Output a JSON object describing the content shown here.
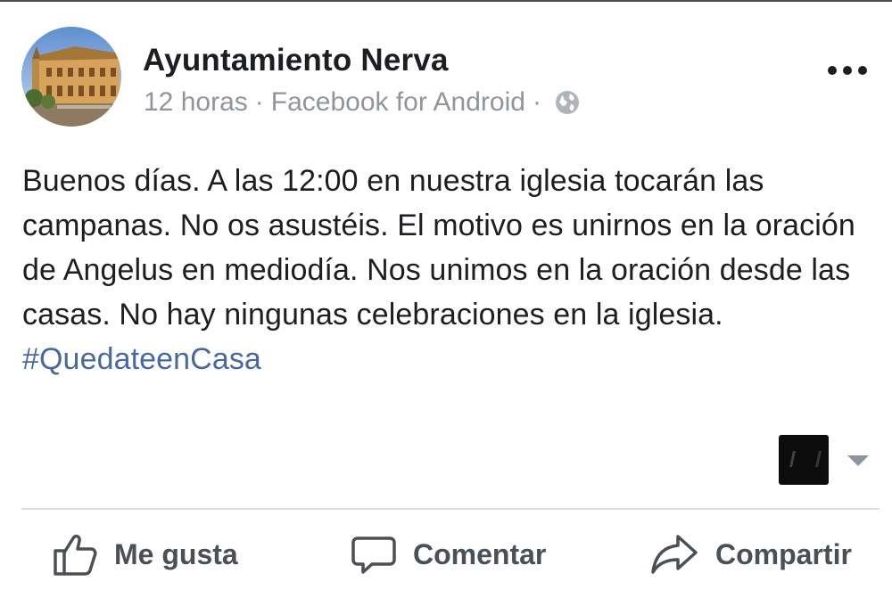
{
  "post": {
    "author": "Ayuntamiento Nerva",
    "time": "12 horas",
    "separator": "·",
    "source": "Facebook for Android",
    "text": "Buenos días. A las 12:00 en nuestra iglesia tocarán las campanas. No os asustéis. El motivo es unirnos en la oración de Angelus en mediodía. Nos unimos en la oración desde las casas. No hay ningunas celebraciones en la iglesia.",
    "hashtag": "#QuedateenCasa"
  },
  "icons": {
    "privacy": "globe-icon",
    "menu": "more-options-icon",
    "like": "thumbs-up-icon",
    "comment": "speech-bubble-icon",
    "share": "share-arrow-icon"
  },
  "actions": {
    "like_label": "Me gusta",
    "comment_label": "Comentar",
    "share_label": "Compartir"
  },
  "colors": {
    "text": "#1c1e21",
    "meta": "#90949c",
    "link": "#4b67a1",
    "action": "#4b4f56"
  }
}
